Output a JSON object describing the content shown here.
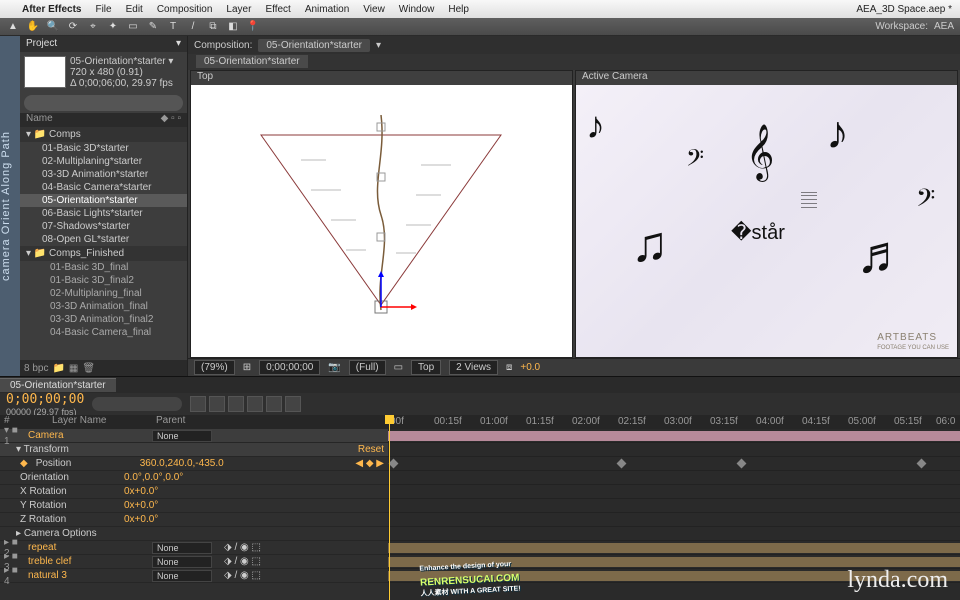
{
  "menubar": {
    "apple": "",
    "app": "After Effects",
    "items": [
      "File",
      "Edit",
      "Composition",
      "Layer",
      "Effect",
      "Animation",
      "View",
      "Window",
      "Help"
    ]
  },
  "docTitle": "AEA_3D Space.aep *",
  "workspace": {
    "label": "Workspace:",
    "value": "AEA"
  },
  "sidelabel": "camera Orient Along Path",
  "project": {
    "title": "Project",
    "compName": "05-Orientation*starter ▾",
    "res": "720 x 480 (0.91)",
    "dur": "Δ 0;00;06;00, 29.97 fps",
    "nameCol": "Name",
    "folders": [
      {
        "name": "Comps",
        "items": [
          "01-Basic 3D*starter",
          "02-Multiplaning*starter",
          "03-3D Animation*starter",
          "04-Basic Camera*starter",
          "05-Orientation*starter",
          "06-Basic Lights*starter",
          "07-Shadows*starter",
          "08-Open GL*starter"
        ]
      },
      {
        "name": "Comps_Finished",
        "items": [
          "01-Basic 3D_final",
          "01-Basic 3D_final2",
          "02-Multiplaning_final",
          "03-3D Animation_final",
          "03-3D Animation_final2",
          "04-Basic Camera_final"
        ]
      }
    ],
    "selected": "05-Orientation*starter",
    "bpc": "8 bpc"
  },
  "comp": {
    "tabPrefix": "Composition:",
    "name": "05-Orientation*starter",
    "crumb": "05-Orientation*starter",
    "viewL": "Top",
    "viewR": "Active Camera",
    "watermark": "ARTBEATS",
    "watermarkSub": "FOOTAGE YOU CAN USE"
  },
  "viewfoot": {
    "zoom": "(79%)",
    "tc": "0;00;00;00",
    "res": "(Full)",
    "view": "Top",
    "nviews": "2 Views",
    "exp": "+0.0"
  },
  "timeline": {
    "tab": "05-Orientation*starter",
    "tc": "0;00;00;00",
    "tc2": "00000 (29.97 fps)",
    "cols": {
      "num": "#",
      "layer": "Layer Name",
      "parent": "Parent"
    },
    "layers": [
      {
        "n": "1",
        "name": "Camera",
        "parent": "None",
        "sel": true,
        "color": "pink"
      },
      {
        "n": "2",
        "name": "repeat",
        "parent": "None"
      },
      {
        "n": "3",
        "name": "treble clef",
        "parent": "None"
      },
      {
        "n": "4",
        "name": "natural 3",
        "parent": "None"
      }
    ],
    "transform": {
      "label": "Transform",
      "reset": "Reset"
    },
    "props": [
      {
        "name": "Position",
        "value": "360.0,240.0,-435.0",
        "kf": true
      },
      {
        "name": "Orientation",
        "value": "0.0°,0.0°,0.0°"
      },
      {
        "name": "X Rotation",
        "value": "0x+0.0°"
      },
      {
        "name": "Y Rotation",
        "value": "0x+0.0°"
      },
      {
        "name": "Z Rotation",
        "value": "0x+0.0°"
      }
    ],
    "camopts": "Camera Options",
    "ruler": [
      "00f",
      "00:15f",
      "01:00f",
      "01:15f",
      "02:00f",
      "02:15f",
      "03:00f",
      "03:15f",
      "04:00f",
      "04:15f",
      "05:00f",
      "05:15f",
      "06:0"
    ]
  },
  "promo": {
    "t1": "Enhance the design of your",
    "t2": "RENRENSUCAI.COM",
    "t3": "人人素材 WITH A GREAT SITE!"
  },
  "lynda": "lynda.com"
}
